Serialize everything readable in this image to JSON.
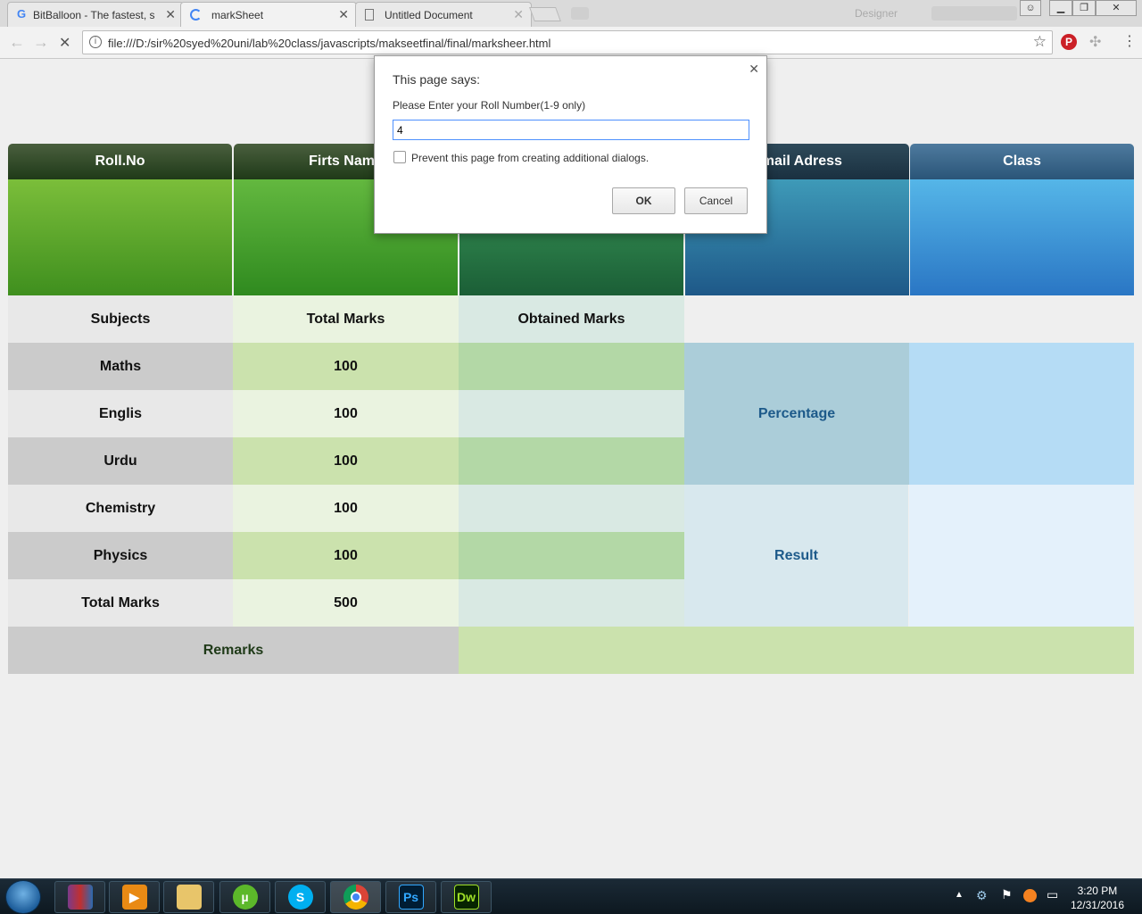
{
  "browser": {
    "tabs": [
      {
        "title": "BitBalloon - The fastest, s"
      },
      {
        "title": "markSheet"
      },
      {
        "title": "Untitled Document"
      }
    ],
    "profile": "Designer",
    "url": "file:///D:/sir%20syed%20uni/lab%20class/javascripts/makseetfinal/final/marksheer.html"
  },
  "sheet": {
    "headers": [
      "Roll.No",
      "Firts Name",
      "",
      "Email Adress",
      "Class"
    ],
    "table_headers": [
      "Subjects",
      "Total Marks",
      "Obtained Marks"
    ],
    "rows": [
      {
        "subject": "Maths",
        "total": "100"
      },
      {
        "subject": "Englis",
        "total": "100"
      },
      {
        "subject": "Urdu",
        "total": "100"
      },
      {
        "subject": "Chemistry",
        "total": "100"
      },
      {
        "subject": "Physics",
        "total": "100"
      },
      {
        "subject": "Total Marks",
        "total": "500"
      }
    ],
    "percentage_label": "Percentage",
    "result_label": "Result",
    "remarks_label": "Remarks"
  },
  "dialog": {
    "title": "This page says:",
    "message": "Please Enter your Roll Number(1-9 only)",
    "value": "4",
    "checkbox_label": "Prevent this page from creating additional dialogs.",
    "ok": "OK",
    "cancel": "Cancel"
  },
  "taskbar": {
    "apps": [
      "winrar-icon",
      "media-player-icon",
      "file-explorer-icon",
      "utorrent-icon",
      "skype-icon",
      "chrome-icon",
      "photoshop-icon",
      "dreamweaver-icon"
    ],
    "ps_label": "Ps",
    "dw_label": "Dw",
    "time": "3:20 PM",
    "date": "12/31/2016"
  }
}
